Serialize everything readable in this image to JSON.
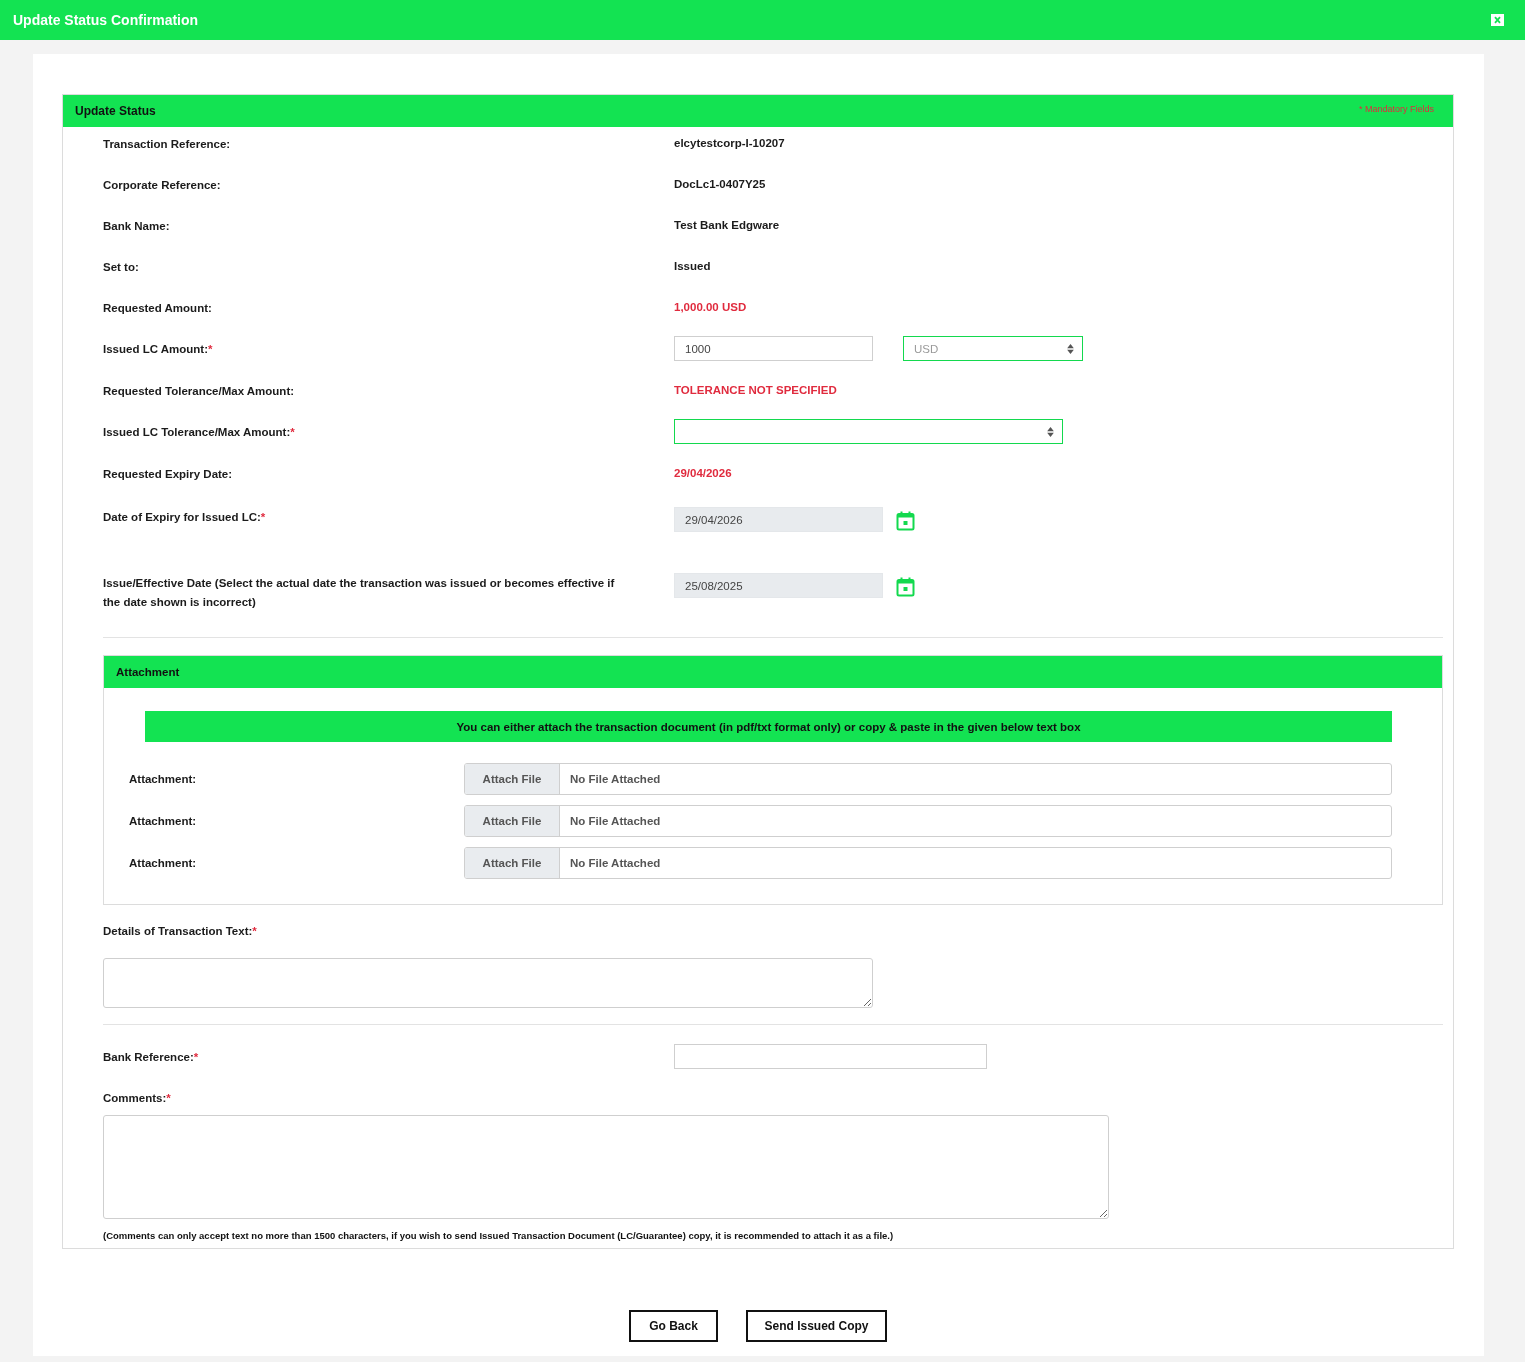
{
  "dialog": {
    "title": "Update Status Confirmation"
  },
  "panel": {
    "title": "Update Status",
    "mandatory_note": "* Mandatory Fields"
  },
  "fields": [
    {
      "kind": "static",
      "label": "Transaction Reference:",
      "value": "elcytestcorp-I-10207",
      "alert": false
    },
    {
      "kind": "static",
      "label": "Corporate Reference:",
      "value": "DocLc1-0407Y25",
      "alert": false
    },
    {
      "kind": "static",
      "label": "Bank Name:",
      "value": "Test Bank Edgware",
      "alert": false
    },
    {
      "kind": "static",
      "label": "Set to:",
      "value": "Issued",
      "alert": false
    },
    {
      "kind": "static",
      "label": "Requested Amount:",
      "value": "1,000.00 USD",
      "alert": true
    },
    {
      "kind": "amount",
      "label": "Issued LC Amount:",
      "required_mark": "*",
      "value": "1000",
      "currency": "USD"
    },
    {
      "kind": "static",
      "label": "Requested Tolerance/Max Amount:",
      "value": "TOLERANCE NOT SPECIFIED",
      "alert": true
    },
    {
      "kind": "select",
      "label": "Issued LC Tolerance/Max Amount:",
      "required_mark": "*"
    },
    {
      "kind": "static",
      "label": "Requested Expiry Date:",
      "value": "29/04/2026",
      "alert": true
    },
    {
      "kind": "date",
      "label": "Date of Expiry for Issued LC:",
      "required_mark": "*",
      "value": "29/04/2026",
      "readonly": true
    },
    {
      "kind": "date",
      "label": "Issue/Effective Date (Select the actual date the transaction was issued or becomes effective if the date shown is incorrect)",
      "value": "25/08/2025",
      "readonly": true
    }
  ],
  "attachment": {
    "title": "Attachment",
    "notice": "You can either attach the transaction document (in pdf/txt format only) or copy & paste in the given below text box",
    "rows": [
      {
        "label": "Attachment:",
        "button": "Attach File",
        "status": "No File Attached"
      },
      {
        "label": "Attachment:",
        "button": "Attach File",
        "status": "No File Attached"
      },
      {
        "label": "Attachment:",
        "button": "Attach File",
        "status": "No File Attached"
      }
    ]
  },
  "transaction_text": {
    "label": "Details of Transaction Text:",
    "required_mark": "*"
  },
  "bank_reference": {
    "label": "Bank Reference:",
    "required_mark": "*"
  },
  "comments": {
    "label": "Comments:",
    "required_mark": "*",
    "note": "(Comments can only accept text no more than 1500 characters, if you wish to send Issued Transaction Document (LC/Guarantee) copy, it is recommended to attach it as a file.)"
  },
  "buttons": [
    {
      "label": "Go Back"
    },
    {
      "label": "Send Issued Copy"
    }
  ]
}
